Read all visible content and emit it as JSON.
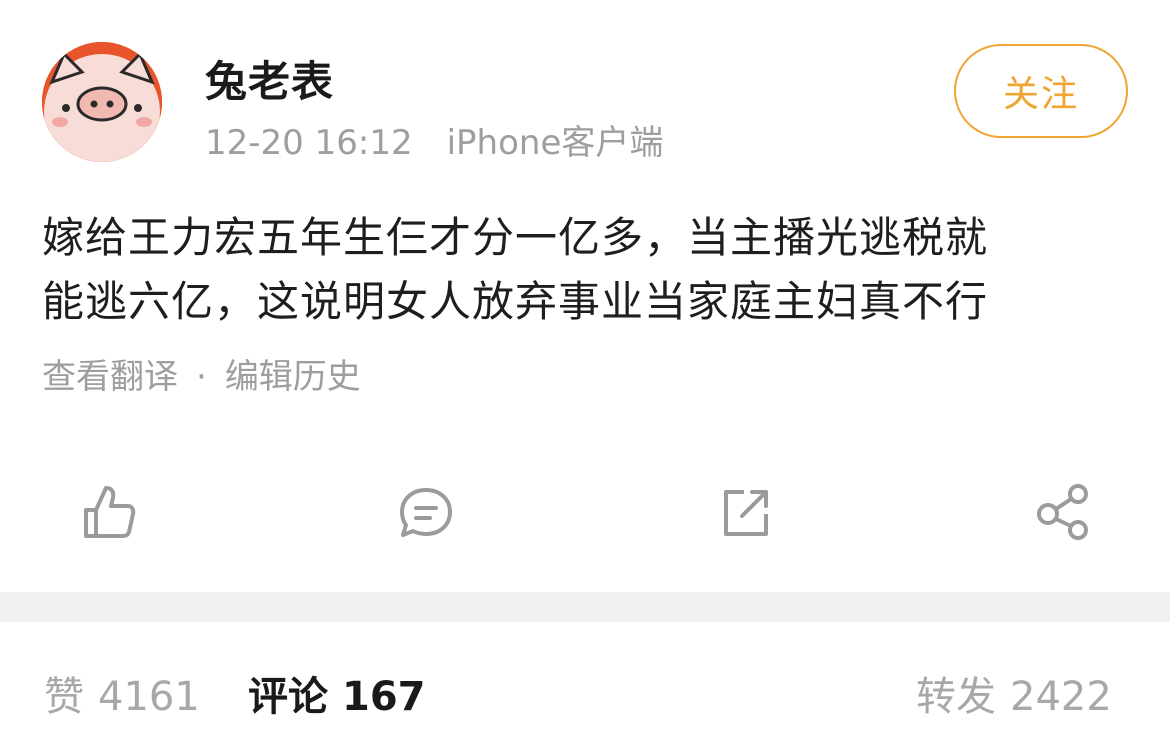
{
  "post": {
    "username": "兔老表",
    "time": "12-20 16:12",
    "source": "iPhone客户端",
    "follow_label": "关注",
    "content_lines": [
      "嫁给王力宏五年生仨才分一亿多，当主播光逃税就",
      "能逃六亿，这说明女人放弃事业当家庭主妇真不行"
    ],
    "translate_label": "查看翻译",
    "separator": "·",
    "edit_history_label": "编辑历史"
  },
  "toolbar": {
    "icons": [
      "thumbs-up-icon",
      "comment-icon",
      "repost-icon",
      "share-icon"
    ]
  },
  "stats": {
    "likes_label": "赞",
    "likes_count": "4161",
    "comments_label": "评论",
    "comments_count": "167",
    "reposts_label": "转发",
    "reposts_count": "2422"
  },
  "colors": {
    "accent": "#f0a431",
    "muted_text": "#9e9e9e",
    "primary_text": "#1a1a1a",
    "divider": "#f1f1f1",
    "icon_gray": "#9b9b9b",
    "avatar_bg": "#e9552a",
    "avatar_face": "#f7d7d2"
  }
}
